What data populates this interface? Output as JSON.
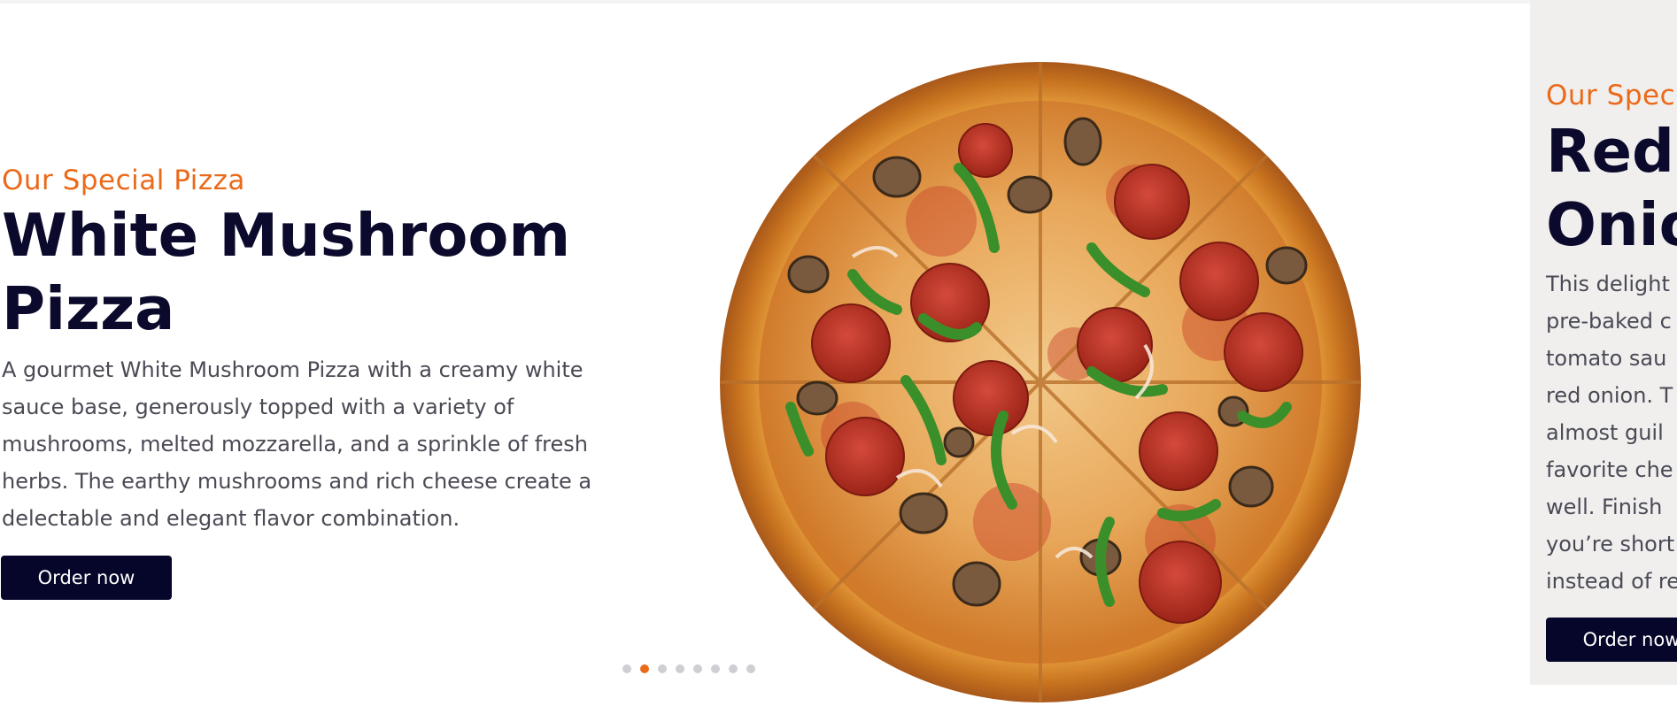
{
  "slides": [
    {
      "eyebrow": "Our Special Pizza",
      "title_line1": "White Mushroom",
      "title_line2": "Pizza",
      "description": "A gourmet White Mushroom Pizza with a creamy white sauce base, generously topped with a variety of mushrooms, melted mozzarella, and a sprinkle of fresh herbs. The earthy mushrooms and rich cheese create a delectable and elegant flavor combination.",
      "button_label": "Order now"
    },
    {
      "eyebrow": "Our Speci",
      "title_line1": "Red",
      "title_line2": "Onio",
      "description_lines": [
        "This delight",
        "pre-baked c",
        "tomato sau",
        "red onion. T",
        "almost guil",
        "favorite che",
        "well. Finish",
        "you’re short",
        "instead of re"
      ],
      "button_label": "Order now"
    }
  ],
  "pagination": {
    "count": 8,
    "active_index": 1
  },
  "colors": {
    "accent": "#ea6a1a",
    "heading": "#0b0a2c",
    "button": "#06052a",
    "side_panel": "#f1eeee"
  },
  "icons": {
    "pizza": "pizza-image"
  }
}
